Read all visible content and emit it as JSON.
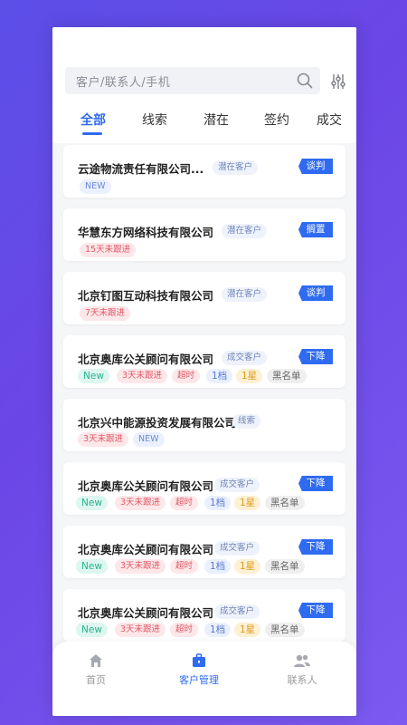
{
  "search": {
    "placeholder": "客户/联系人/手机"
  },
  "tabs": [
    {
      "label": "全部",
      "active": true
    },
    {
      "label": "线索"
    },
    {
      "label": "潜在"
    },
    {
      "label": "签约"
    },
    {
      "label": "成交"
    }
  ],
  "cards": [
    {
      "title": "云途物流责任有限公司...",
      "stage": "潜在客户",
      "status": "谈判",
      "tags": [
        "NEW"
      ]
    },
    {
      "title": "华慧东方网络科技有限公司",
      "stage": "潜在客户",
      "status": "搁置",
      "tags": [
        "15天未跟进"
      ]
    },
    {
      "title": "北京钉图互动科技有限公司",
      "stage": "潜在客户",
      "status": "谈判",
      "tags": [
        "7天未跟进"
      ]
    },
    {
      "title": "北京奥库公关顾问有限公司",
      "stage": "成交客户",
      "status": "下降",
      "tags": [
        "New",
        "3天未跟进",
        "超时",
        "1档",
        "1星",
        "黑名单"
      ]
    },
    {
      "title": "北京兴中能源投资发展有限公司",
      "stage": "线索",
      "status": "",
      "tags": [
        "3天未跟进",
        "NEW"
      ]
    },
    {
      "title": "北京奥库公关顾问有限公司",
      "stage": "成交客户",
      "status": "下降",
      "tags": [
        "New",
        "3天未跟进",
        "超时",
        "1档",
        "1星",
        "黑名单"
      ]
    },
    {
      "title": "北京奥库公关顾问有限公司",
      "stage": "成交客户",
      "status": "下降",
      "tags": [
        "New",
        "3天未跟进",
        "超时",
        "1档",
        "1星",
        "黑名单"
      ]
    },
    {
      "title": "北京奥库公关顾问有限公司",
      "stage": "成交客户",
      "status": "下降",
      "tags": [
        "New",
        "3天未跟进",
        "超时",
        "1档",
        "1星",
        "黑名单"
      ]
    }
  ],
  "tabbar": [
    {
      "label": "首页",
      "icon": "home-icon"
    },
    {
      "label": "客户管理",
      "icon": "briefcase-icon",
      "active": true
    },
    {
      "label": "联系人",
      "icon": "contacts-icon"
    }
  ],
  "colors": {
    "accent": "#2f6bf0",
    "background": "#5b4fe8"
  }
}
